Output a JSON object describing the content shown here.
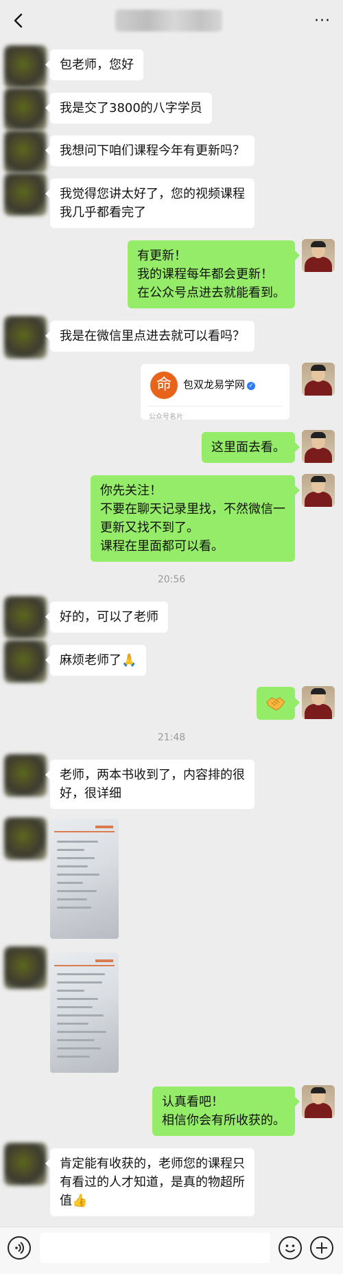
{
  "header": {
    "title": "",
    "back_icon": "chevron-left-icon",
    "more_label": "···"
  },
  "messages": {
    "m1": {
      "lines": [
        "包老师，您好"
      ]
    },
    "m2": {
      "lines": [
        "我是交了3800的八字学员"
      ]
    },
    "m3": {
      "lines": [
        "我想问下咱们课程今年有更新吗？"
      ]
    },
    "m4": {
      "lines": [
        "我觉得您讲太好了，您的视频课程",
        "我几乎都看完了"
      ]
    },
    "m5": {
      "lines": [
        "有更新！",
        "我的课程每年都会更新！",
        "在公众号点进去就能看到。"
      ]
    },
    "m6": {
      "lines": [
        "我是在微信里点进去就可以看吗？"
      ]
    },
    "card": {
      "logo": "命",
      "name": "包双龙易学网",
      "verified": "✓",
      "kind": "公众号名片"
    },
    "m7": {
      "lines": [
        "这里面去看。"
      ]
    },
    "m8": {
      "lines": [
        "你先关注！",
        "不要在聊天记录里找，不然微信一",
        "更新又找不到了。",
        "课程在里面都可以看。"
      ]
    },
    "time1": "20:56",
    "m9": {
      "lines": [
        "好的，可以了老师"
      ]
    },
    "m10": {
      "lines": [
        "麻烦老师了🙏"
      ]
    },
    "m11": {
      "emoji": "handshake-emoji"
    },
    "time2": "21:48",
    "m12": {
      "lines": [
        "老师，两本书收到了，内容排的很",
        "好，很详细"
      ]
    },
    "m13": {
      "image": "book-page-photo"
    },
    "m14": {
      "image": "book-page-photo"
    },
    "m15": {
      "lines": [
        "认真看吧！",
        "相信你会有所收获的。"
      ]
    },
    "m16": {
      "lines": [
        "肯定能有收获的，老师您的课程只",
        "有看过的人才知道，是真的物超所",
        "值👍"
      ]
    }
  },
  "input_bar": {
    "voice_icon": "voice-icon",
    "emoji_icon": "emoji-icon",
    "plus_icon": "plus-icon",
    "input_value": ""
  },
  "colors": {
    "background": "#ededed",
    "bubble_self": "#95ec69",
    "bubble_other": "#ffffff",
    "timestamp": "#9a9a9a"
  }
}
